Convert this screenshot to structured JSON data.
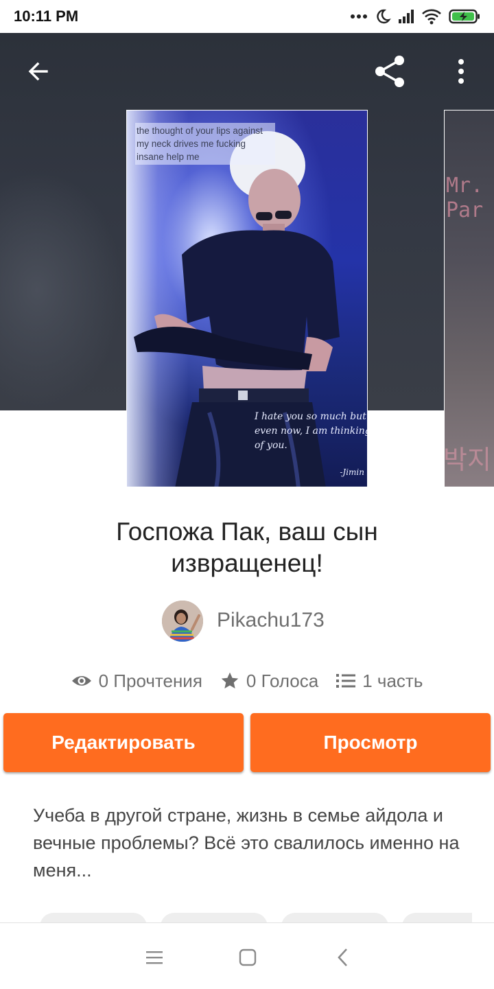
{
  "status_bar": {
    "time": "10:11 PM",
    "icons": [
      "more-dots-icon",
      "moon-icon",
      "signal-icon",
      "wifi-icon",
      "battery-charging-icon"
    ]
  },
  "header": {
    "icons": [
      "back-arrow-icon",
      "share-icon",
      "more-vertical-icon"
    ]
  },
  "cover": {
    "text_top": "the thought of your lips against my neck drives me fucking insane help me",
    "text_bottom": "I hate you so much but even now, I am thinking of you.",
    "signature": "-Jimin",
    "side_text": "Mr.\nPar",
    "side_korean": "박지"
  },
  "story": {
    "title": "Госпожа Пак, ваш сын извращенец!",
    "author": "Pikachu173",
    "description": "Учеба в другой стране, жизнь в семье айдола и вечные проблемы? Всё это свалилось именно на меня..."
  },
  "stats": {
    "reads": "0 Прочтения",
    "votes": "0 Голоса",
    "parts": "1 часть"
  },
  "actions": {
    "edit_label": "Редактировать",
    "view_label": "Просмотр"
  },
  "colors": {
    "accent": "#ff6c1f",
    "hero_bg": "#333843"
  },
  "nav_bar": {
    "icons": [
      "menu-icon",
      "home-square-icon",
      "back-chevron-icon"
    ]
  }
}
